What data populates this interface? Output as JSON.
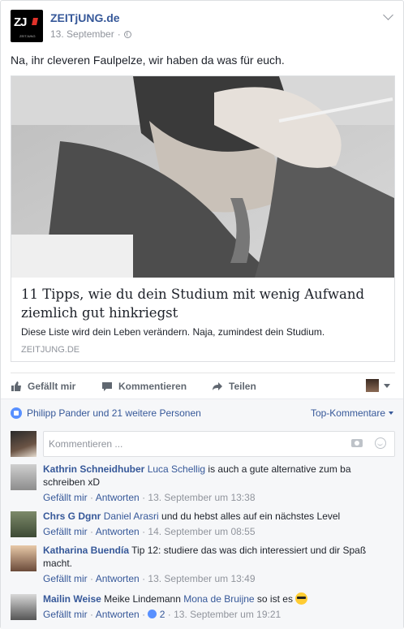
{
  "header": {
    "logo_text": "ZJ",
    "logo_sub": "ZEITJUNG",
    "page_name": "ZEITjUNG.de",
    "date": "13. September",
    "separator": "·"
  },
  "post": {
    "text": "Na, ihr cleveren Faulpelze, wir haben da was für euch."
  },
  "link": {
    "title": "11 Tipps, wie du dein Studium mit wenig Aufwand ziemlich gut hinkriegst",
    "description": "Diese Liste wird dein Leben verändern. Naja, zumindest dein Studium.",
    "domain": "ZEITJUNG.DE"
  },
  "actions": {
    "like": "Gefällt mir",
    "comment": "Kommentieren",
    "share": "Teilen"
  },
  "reactions": {
    "likers": "Philipp Pander und 21 weitere Personen",
    "sort": "Top-Kommentare"
  },
  "composer": {
    "placeholder": "Kommentieren ..."
  },
  "comments": [
    {
      "author": "Kathrin Schneidhuber",
      "tag": "Luca Schellig",
      "text": " is auch a gute alternative zum ba schreiben xD",
      "like": "Gefällt mir",
      "reply": "Antworten",
      "time": "13. September um 13:38"
    },
    {
      "author": "Chrs G Dgnr",
      "tag": "Daniel Arasri",
      "text": " und du hebst alles auf ein nächstes Level",
      "like": "Gefällt mir",
      "reply": "Antworten",
      "time": "14. September um 08:55"
    },
    {
      "author": "Katharina Buendía",
      "tag": "",
      "text": " Tip 12: studiere das was dich interessiert und dir Spaß macht.",
      "like": "Gefällt mir",
      "reply": "Antworten",
      "time": "13. September um 13:49"
    },
    {
      "author": "Mailin Weise",
      "tag": "",
      "text_before": " Meike Lindemann ",
      "tag2": "Mona de Bruijne",
      "text": " so ist es",
      "like": "Gefällt mir",
      "reply": "Antworten",
      "likes_count": "2",
      "time": "13. September um 19:21"
    }
  ],
  "colors": {
    "link_blue": "#365899",
    "meta_gray": "#90949c",
    "like_blue": "#5890ff",
    "bar_bg": "#f6f7f9"
  }
}
